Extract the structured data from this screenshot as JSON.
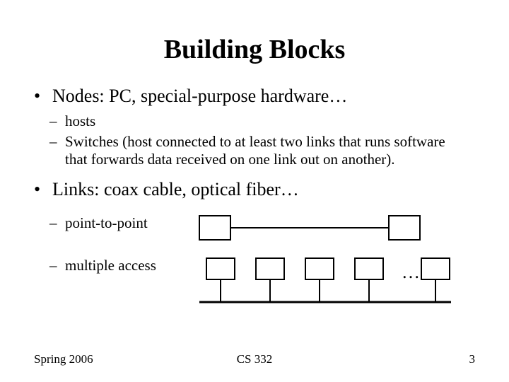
{
  "title": "Building Blocks",
  "bullets": {
    "nodes_label": "Nodes: PC, special-purpose hardware…",
    "nodes_sub": {
      "hosts": "hosts",
      "switches": "Switches (host connected to at least two links that runs software that forwards data received on one link out on another)."
    },
    "links_label": "Links: coax cable, optical fiber…",
    "links_sub": {
      "p2p": "point-to-point",
      "multi": "multiple access"
    }
  },
  "diagrams": {
    "multi_ellipsis": "…"
  },
  "footer": {
    "left": "Spring 2006",
    "center": "CS 332",
    "right": "3"
  }
}
